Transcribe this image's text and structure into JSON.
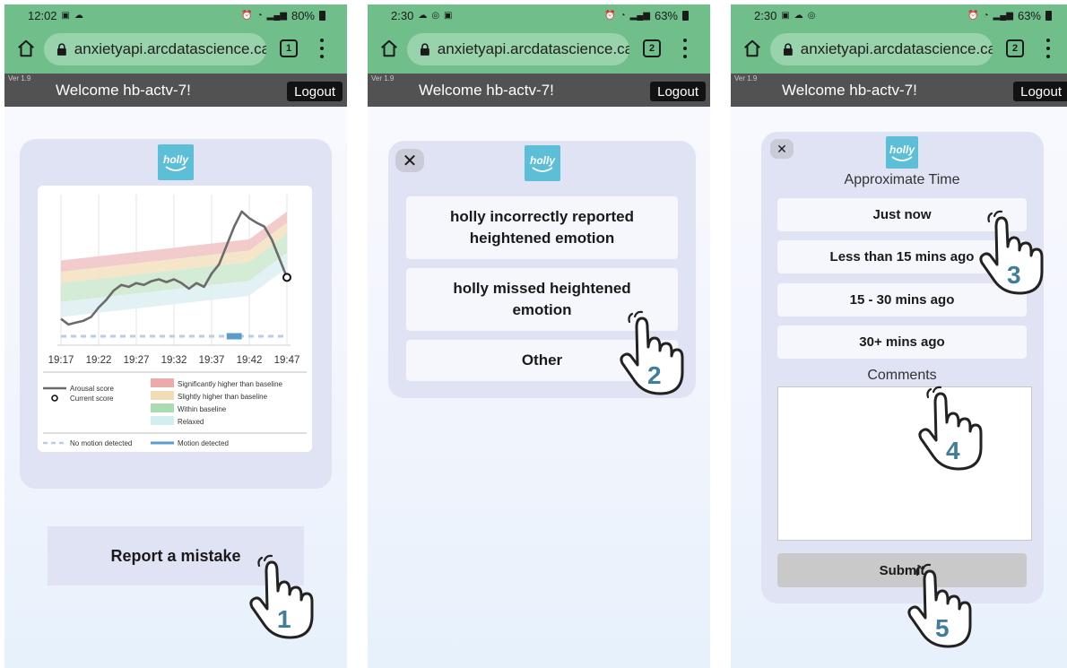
{
  "shared": {
    "url": "anxietyapi.arcdatascience.ca",
    "version": "Ver 1.9",
    "welcome": "Welcome hb-actv-7!",
    "logout": "Logout",
    "logo_text": "holly"
  },
  "screens": [
    {
      "time": "12:02",
      "battery": "80%",
      "tab_count": "1",
      "status_left_icons": [
        "image-icon",
        "cloud-icon"
      ],
      "status_right_icons": [
        "alarm-icon",
        "wifi-icon",
        "signal-icon",
        "battery-icon"
      ]
    },
    {
      "time": "2:30",
      "battery": "63%",
      "tab_count": "2",
      "status_left_icons": [
        "cloud-icon",
        "sync-icon",
        "image-icon"
      ],
      "status_right_icons": [
        "alarm-icon",
        "wifi-icon",
        "signal-icon",
        "battery-icon"
      ]
    },
    {
      "time": "2:30",
      "battery": "63%",
      "tab_count": "2",
      "status_left_icons": [
        "image-icon",
        "cloud-icon",
        "sync-icon"
      ],
      "status_right_icons": [
        "alarm-icon",
        "wifi-icon",
        "signal-icon",
        "battery-icon"
      ]
    }
  ],
  "chart_data": {
    "type": "line",
    "categories": [
      "19:17",
      "19:22",
      "19:27",
      "19:32",
      "19:37",
      "19:42",
      "19:47"
    ],
    "series": [
      {
        "name": "Arousal score",
        "values": [
          {
            "t": "19:17",
            "v": 28
          },
          {
            "t": "19:18",
            "v": 22
          },
          {
            "t": "19:19",
            "v": 24
          },
          {
            "t": "19:20",
            "v": 26
          },
          {
            "t": "19:21",
            "v": 30
          },
          {
            "t": "19:22",
            "v": 40
          },
          {
            "t": "19:23",
            "v": 48
          },
          {
            "t": "19:24",
            "v": 58
          },
          {
            "t": "19:25",
            "v": 64
          },
          {
            "t": "19:26",
            "v": 62
          },
          {
            "t": "19:27",
            "v": 66
          },
          {
            "t": "19:28",
            "v": 64
          },
          {
            "t": "19:29",
            "v": 68
          },
          {
            "t": "19:30",
            "v": 70
          },
          {
            "t": "19:31",
            "v": 67
          },
          {
            "t": "19:32",
            "v": 70
          },
          {
            "t": "19:33",
            "v": 66
          },
          {
            "t": "19:34",
            "v": 60
          },
          {
            "t": "19:35",
            "v": 66
          },
          {
            "t": "19:36",
            "v": 62
          },
          {
            "t": "19:37",
            "v": 76
          },
          {
            "t": "19:38",
            "v": 86
          },
          {
            "t": "19:39",
            "v": 106
          },
          {
            "t": "19:40",
            "v": 126
          },
          {
            "t": "19:41",
            "v": 142
          },
          {
            "t": "19:42",
            "v": 135
          },
          {
            "t": "19:43",
            "v": 130
          },
          {
            "t": "19:44",
            "v": 126
          },
          {
            "t": "19:45",
            "v": 112
          },
          {
            "t": "19:46",
            "v": 92
          },
          {
            "t": "19:47",
            "v": 72
          }
        ]
      }
    ],
    "current_score": 72,
    "bands": [
      "Significantly higher than baseline",
      "Slightly higher than baseline",
      "Within baseline",
      "Relaxed"
    ],
    "band_colors": [
      "#f1c6c6",
      "#f4e3c4",
      "#cfe9d2",
      "#dff0f2"
    ],
    "motion_detected_segments": [
      [
        "19:39",
        "19:41"
      ]
    ],
    "legend": {
      "arousal": "Arousal score",
      "current": "Current score",
      "sig_higher": "Significantly higher than baseline",
      "slight_higher": "Slightly higher than baseline",
      "within": "Within baseline",
      "relaxed": "Relaxed",
      "no_motion": "No motion detected",
      "motion": "Motion detected"
    },
    "ylim": [
      0,
      160
    ],
    "grid": true,
    "legend_placement": "bottom"
  },
  "report_button": "Report a mistake",
  "mistake_options": [
    "holly incorrectly reported heightened emotion",
    "holly missed heightened emotion",
    "Other"
  ],
  "time_form": {
    "approx_title": "Approximate Time",
    "options": [
      "Just now",
      "Less than 15 mins ago",
      "15 - 30 mins ago",
      "30+ mins ago"
    ],
    "comments_label": "Comments",
    "submit": "Submit"
  },
  "step_markers": [
    "1",
    "2",
    "3",
    "4",
    "5"
  ],
  "colors": {
    "browser_green": "#70bf8b",
    "app_header": "#525252",
    "card": "#dfe3f3",
    "logo": "#5cbfd7",
    "step_number": "#3f7d9a",
    "arousal_line": "#6b6b6b",
    "motion_bar": "#5b9ccd"
  }
}
